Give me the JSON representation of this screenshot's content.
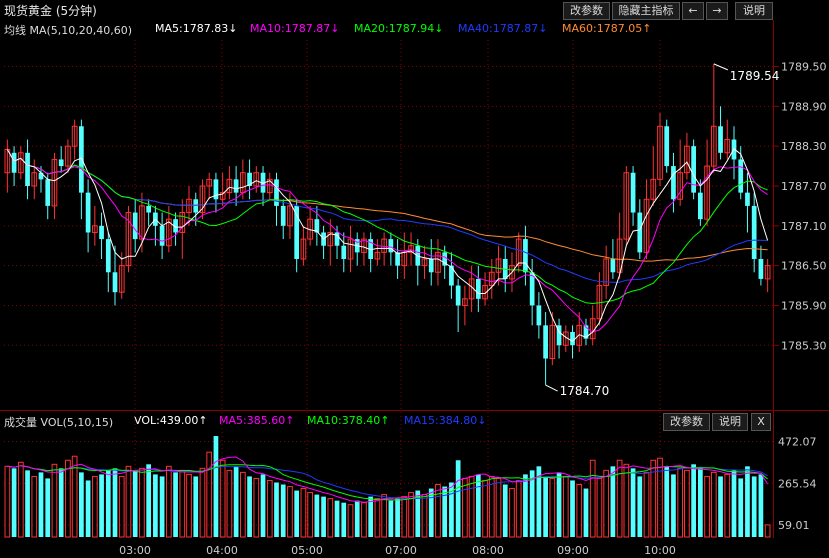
{
  "header": {
    "title": "现货黄金 (5分钟)",
    "buttons": [
      "改参数",
      "隐藏主指标",
      "←",
      "→",
      "说明"
    ]
  },
  "price_legend": {
    "main": "均线 MA(5,10,20,40,60)",
    "ma5": "MA5:1787.83↓",
    "ma10": "MA10:1787.87↓",
    "ma20": "MA20:1787.94↓",
    "ma40": "MA40:1787.87↓",
    "ma60": "MA60:1787.05↑"
  },
  "vol_legend": {
    "main": "成交量 VOL(5,10,15)",
    "vol": "VOL:439.00↑",
    "ma5": "MA5:385.60↑",
    "ma10": "MA10:378.40↑",
    "ma15": "MA15:384.80↓",
    "buttons": [
      "改参数",
      "说明",
      "X"
    ]
  },
  "colors": {
    "up": "#ff3232",
    "down": "#54ffff",
    "ma5": "#ffffff",
    "ma10": "#ff00ff",
    "ma20": "#00ff00",
    "ma40": "#1e3cff",
    "ma60": "#ff8c32",
    "grid": "#8b0000"
  },
  "chart_data": [
    {
      "type": "candlestick",
      "title": "现货黄金 (5分钟)",
      "y_ticks": [
        "1789.50",
        "1788.90",
        "1788.30",
        "1787.70",
        "1787.10",
        "1786.50",
        "1785.90",
        "1785.30"
      ],
      "ylim": [
        1784.4,
        1789.9
      ],
      "high_annotation": "1789.54",
      "low_annotation": "1784.70",
      "candles": [
        [
          1787.9,
          1788.25,
          1787.6,
          1788.4
        ],
        [
          1788.2,
          1787.9,
          1787.7,
          1788.3
        ],
        [
          1787.9,
          1788.2,
          1787.8,
          1788.3
        ],
        [
          1788.2,
          1787.7,
          1787.5,
          1788.4
        ],
        [
          1787.7,
          1787.9,
          1787.5,
          1788.1
        ],
        [
          1787.9,
          1787.8,
          1787.6,
          1788.0
        ],
        [
          1787.8,
          1787.4,
          1787.2,
          1787.9
        ],
        [
          1787.4,
          1788.1,
          1787.2,
          1788.2
        ],
        [
          1788.1,
          1788.0,
          1787.9,
          1788.3
        ],
        [
          1788.0,
          1788.3,
          1787.9,
          1788.4
        ],
        [
          1788.3,
          1788.6,
          1788.1,
          1788.7
        ],
        [
          1788.6,
          1787.6,
          1787.2,
          1788.7
        ],
        [
          1787.6,
          1787.0,
          1786.7,
          1787.8
        ],
        [
          1787.0,
          1787.1,
          1786.8,
          1787.4
        ],
        [
          1787.1,
          1786.9,
          1786.6,
          1787.3
        ],
        [
          1786.9,
          1786.4,
          1786.1,
          1787.0
        ],
        [
          1786.4,
          1786.1,
          1785.9,
          1786.8
        ],
        [
          1786.1,
          1786.5,
          1786.0,
          1786.7
        ],
        [
          1786.5,
          1787.3,
          1786.4,
          1787.4
        ],
        [
          1787.3,
          1786.9,
          1786.7,
          1787.5
        ],
        [
          1786.9,
          1787.4,
          1786.7,
          1787.6
        ],
        [
          1787.4,
          1787.3,
          1787.1,
          1787.5
        ],
        [
          1787.3,
          1787.1,
          1786.8,
          1787.4
        ],
        [
          1787.1,
          1786.8,
          1786.6,
          1787.3
        ],
        [
          1786.8,
          1787.2,
          1786.7,
          1787.4
        ],
        [
          1787.2,
          1787.0,
          1786.8,
          1787.3
        ],
        [
          1787.0,
          1787.3,
          1786.6,
          1787.5
        ],
        [
          1787.3,
          1787.5,
          1787.1,
          1787.7
        ],
        [
          1787.5,
          1787.3,
          1787.1,
          1787.6
        ],
        [
          1787.3,
          1787.7,
          1787.2,
          1787.8
        ],
        [
          1787.7,
          1787.8,
          1787.5,
          1787.9
        ],
        [
          1787.8,
          1787.5,
          1787.3,
          1787.9
        ],
        [
          1787.5,
          1787.6,
          1787.4,
          1787.9
        ],
        [
          1787.6,
          1787.8,
          1787.5,
          1788.0
        ],
        [
          1787.8,
          1787.6,
          1787.4,
          1788.0
        ],
        [
          1787.6,
          1787.9,
          1787.5,
          1788.1
        ],
        [
          1787.9,
          1787.7,
          1787.5,
          1788.1
        ],
        [
          1787.7,
          1787.9,
          1787.6,
          1788.0
        ],
        [
          1787.9,
          1787.6,
          1787.4,
          1788.0
        ],
        [
          1787.6,
          1787.8,
          1787.5,
          1787.9
        ],
        [
          1787.8,
          1787.4,
          1787.1,
          1787.9
        ],
        [
          1787.4,
          1787.1,
          1786.9,
          1787.5
        ],
        [
          1787.1,
          1787.4,
          1786.9,
          1787.6
        ],
        [
          1787.4,
          1786.6,
          1786.4,
          1787.5
        ],
        [
          1786.6,
          1786.9,
          1786.5,
          1787.1
        ],
        [
          1786.9,
          1787.2,
          1786.8,
          1787.4
        ],
        [
          1787.2,
          1787.0,
          1786.8,
          1787.4
        ],
        [
          1787.0,
          1786.8,
          1786.6,
          1787.1
        ],
        [
          1786.8,
          1787.0,
          1786.5,
          1787.2
        ],
        [
          1787.0,
          1786.8,
          1786.6,
          1787.1
        ],
        [
          1786.8,
          1786.6,
          1786.4,
          1787.0
        ],
        [
          1786.6,
          1786.9,
          1786.4,
          1787.1
        ],
        [
          1786.9,
          1786.7,
          1786.5,
          1787.0
        ],
        [
          1786.7,
          1786.9,
          1786.5,
          1787.0
        ],
        [
          1786.9,
          1786.6,
          1786.4,
          1787.0
        ],
        [
          1786.6,
          1786.7,
          1786.5,
          1786.9
        ],
        [
          1786.7,
          1786.9,
          1786.5,
          1787.0
        ],
        [
          1786.9,
          1786.7,
          1786.5,
          1787.0
        ],
        [
          1786.7,
          1786.5,
          1786.3,
          1786.9
        ],
        [
          1786.5,
          1786.7,
          1786.3,
          1787.0
        ],
        [
          1786.7,
          1786.8,
          1786.5,
          1787.0
        ],
        [
          1786.8,
          1786.5,
          1786.2,
          1786.9
        ],
        [
          1786.5,
          1786.6,
          1786.3,
          1786.8
        ],
        [
          1786.6,
          1786.4,
          1786.2,
          1786.9
        ],
        [
          1786.4,
          1786.7,
          1786.2,
          1786.9
        ],
        [
          1786.7,
          1786.5,
          1786.3,
          1786.8
        ],
        [
          1786.5,
          1786.2,
          1786.0,
          1786.7
        ],
        [
          1786.2,
          1785.9,
          1785.5,
          1786.3
        ],
        [
          1785.9,
          1786.0,
          1785.6,
          1786.2
        ],
        [
          1786.0,
          1786.3,
          1785.8,
          1786.5
        ],
        [
          1786.3,
          1786.0,
          1785.8,
          1786.5
        ],
        [
          1786.0,
          1786.2,
          1785.9,
          1786.4
        ],
        [
          1786.2,
          1786.4,
          1786.0,
          1786.6
        ],
        [
          1786.4,
          1786.6,
          1786.2,
          1786.8
        ],
        [
          1786.6,
          1786.3,
          1786.1,
          1786.8
        ],
        [
          1786.3,
          1786.5,
          1786.1,
          1786.7
        ],
        [
          1786.5,
          1786.9,
          1786.4,
          1787.0
        ],
        [
          1786.9,
          1786.4,
          1786.2,
          1787.1
        ],
        [
          1786.4,
          1785.9,
          1785.6,
          1786.6
        ],
        [
          1785.9,
          1785.6,
          1785.4,
          1786.1
        ],
        [
          1785.6,
          1785.1,
          1784.7,
          1785.8
        ],
        [
          1785.1,
          1785.6,
          1785.0,
          1785.8
        ],
        [
          1785.6,
          1785.3,
          1785.1,
          1785.7
        ],
        [
          1785.3,
          1785.5,
          1785.2,
          1785.6
        ],
        [
          1785.5,
          1785.3,
          1785.1,
          1785.6
        ],
        [
          1785.3,
          1785.6,
          1785.2,
          1785.8
        ],
        [
          1785.6,
          1785.4,
          1785.3,
          1785.7
        ],
        [
          1785.4,
          1785.7,
          1785.3,
          1785.9
        ],
        [
          1785.7,
          1786.2,
          1785.6,
          1786.4
        ],
        [
          1786.2,
          1786.6,
          1786.0,
          1786.8
        ],
        [
          1786.6,
          1786.4,
          1786.3,
          1786.9
        ],
        [
          1786.4,
          1786.9,
          1786.3,
          1787.3
        ],
        [
          1786.9,
          1787.9,
          1786.8,
          1788.0
        ],
        [
          1787.9,
          1787.3,
          1787.1,
          1788.0
        ],
        [
          1787.3,
          1786.7,
          1786.6,
          1787.5
        ],
        [
          1786.7,
          1787.5,
          1786.6,
          1787.8
        ],
        [
          1787.5,
          1787.8,
          1787.4,
          1788.3
        ],
        [
          1787.8,
          1788.6,
          1787.7,
          1788.8
        ],
        [
          1788.6,
          1788.0,
          1787.9,
          1788.7
        ],
        [
          1788.0,
          1787.5,
          1787.3,
          1788.2
        ],
        [
          1787.5,
          1787.9,
          1787.4,
          1788.4
        ],
        [
          1787.9,
          1788.3,
          1787.8,
          1788.5
        ],
        [
          1788.3,
          1787.6,
          1787.5,
          1788.4
        ],
        [
          1787.6,
          1787.2,
          1787.1,
          1787.8
        ],
        [
          1787.2,
          1788.0,
          1787.1,
          1788.4
        ],
        [
          1788.0,
          1788.6,
          1787.9,
          1789.54
        ],
        [
          1788.6,
          1788.2,
          1788.1,
          1788.9
        ],
        [
          1788.2,
          1788.4,
          1788.1,
          1788.7
        ],
        [
          1788.4,
          1788.1,
          1787.8,
          1788.6
        ],
        [
          1788.1,
          1787.6,
          1787.5,
          1788.3
        ],
        [
          1787.6,
          1787.4,
          1787.0,
          1787.9
        ],
        [
          1787.4,
          1786.6,
          1786.4,
          1787.6
        ],
        [
          1786.6,
          1786.3,
          1786.2,
          1786.8
        ],
        [
          1786.3,
          1786.5,
          1786.1,
          1786.6
        ]
      ]
    },
    {
      "type": "bar",
      "title": "成交量 VOL(5,10,15)",
      "y_ticks": [
        "472.07",
        "265.54",
        "59.01"
      ],
      "ylim": [
        0,
        520
      ],
      "x_ticks": [
        "03:00",
        "04:00",
        "05:00",
        "07:00",
        "08:00",
        "09:00",
        "10:00"
      ],
      "values": [
        350,
        340,
        370,
        330,
        300,
        320,
        290,
        360,
        340,
        380,
        400,
        320,
        280,
        300,
        310,
        330,
        340,
        300,
        350,
        330,
        340,
        360,
        310,
        300,
        350,
        320,
        330,
        310,
        300,
        340,
        420,
        500,
        380,
        330,
        350,
        320,
        300,
        290,
        310,
        280,
        270,
        260,
        250,
        230,
        240,
        220,
        210,
        200,
        190,
        180,
        170,
        160,
        180,
        170,
        200,
        190,
        210,
        180,
        190,
        200,
        220,
        230,
        210,
        240,
        260,
        250,
        270,
        380,
        290,
        300,
        310,
        280,
        300,
        290,
        260,
        240,
        280,
        310,
        330,
        350,
        300,
        290,
        320,
        300,
        280,
        260,
        240,
        380,
        290,
        330,
        350,
        380,
        360,
        340,
        300,
        320,
        380,
        390,
        350,
        310,
        340,
        330,
        360,
        340,
        300,
        320,
        300,
        310,
        330,
        290,
        350,
        300,
        310,
        60
      ],
      "series": [
        {
          "name": "MA5"
        },
        {
          "name": "MA10"
        },
        {
          "name": "MA15"
        }
      ]
    }
  ]
}
